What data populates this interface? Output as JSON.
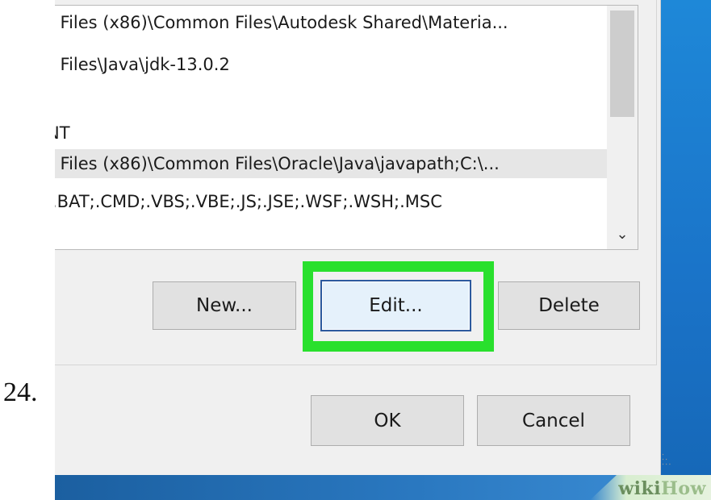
{
  "step_number": "24.",
  "list": {
    "rows": [
      {
        "text": "Files (x86)\\Common Files\\Autodesk Shared\\Materia...",
        "selected": false
      },
      {
        "text": "Files\\Java\\jdk-13.0.2",
        "selected": false
      },
      {
        "text": "",
        "selected": false
      },
      {
        "text": "NT",
        "selected": false
      },
      {
        "text": "Files (x86)\\Common Files\\Oracle\\Java\\javapath;C:\\...",
        "selected": true
      },
      {
        "text": ".BAT;.CMD;.VBS;.VBE;.JS;.JSE;.WSF;.WSH;.MSC",
        "selected": false
      }
    ],
    "scroll_down_icon": "chevron-down-icon"
  },
  "buttons": {
    "new_label": "New...",
    "edit_label": "Edit...",
    "delete_label": "Delete",
    "ok_label": "OK",
    "cancel_label": "Cancel"
  },
  "watermark": {
    "wiki": "wiki",
    "how": "How"
  },
  "colors": {
    "highlight": "#29e02d",
    "default_button_border": "#2d5a9e",
    "selected_row": "#e6e6e6",
    "desktop": "#1a73c8"
  }
}
